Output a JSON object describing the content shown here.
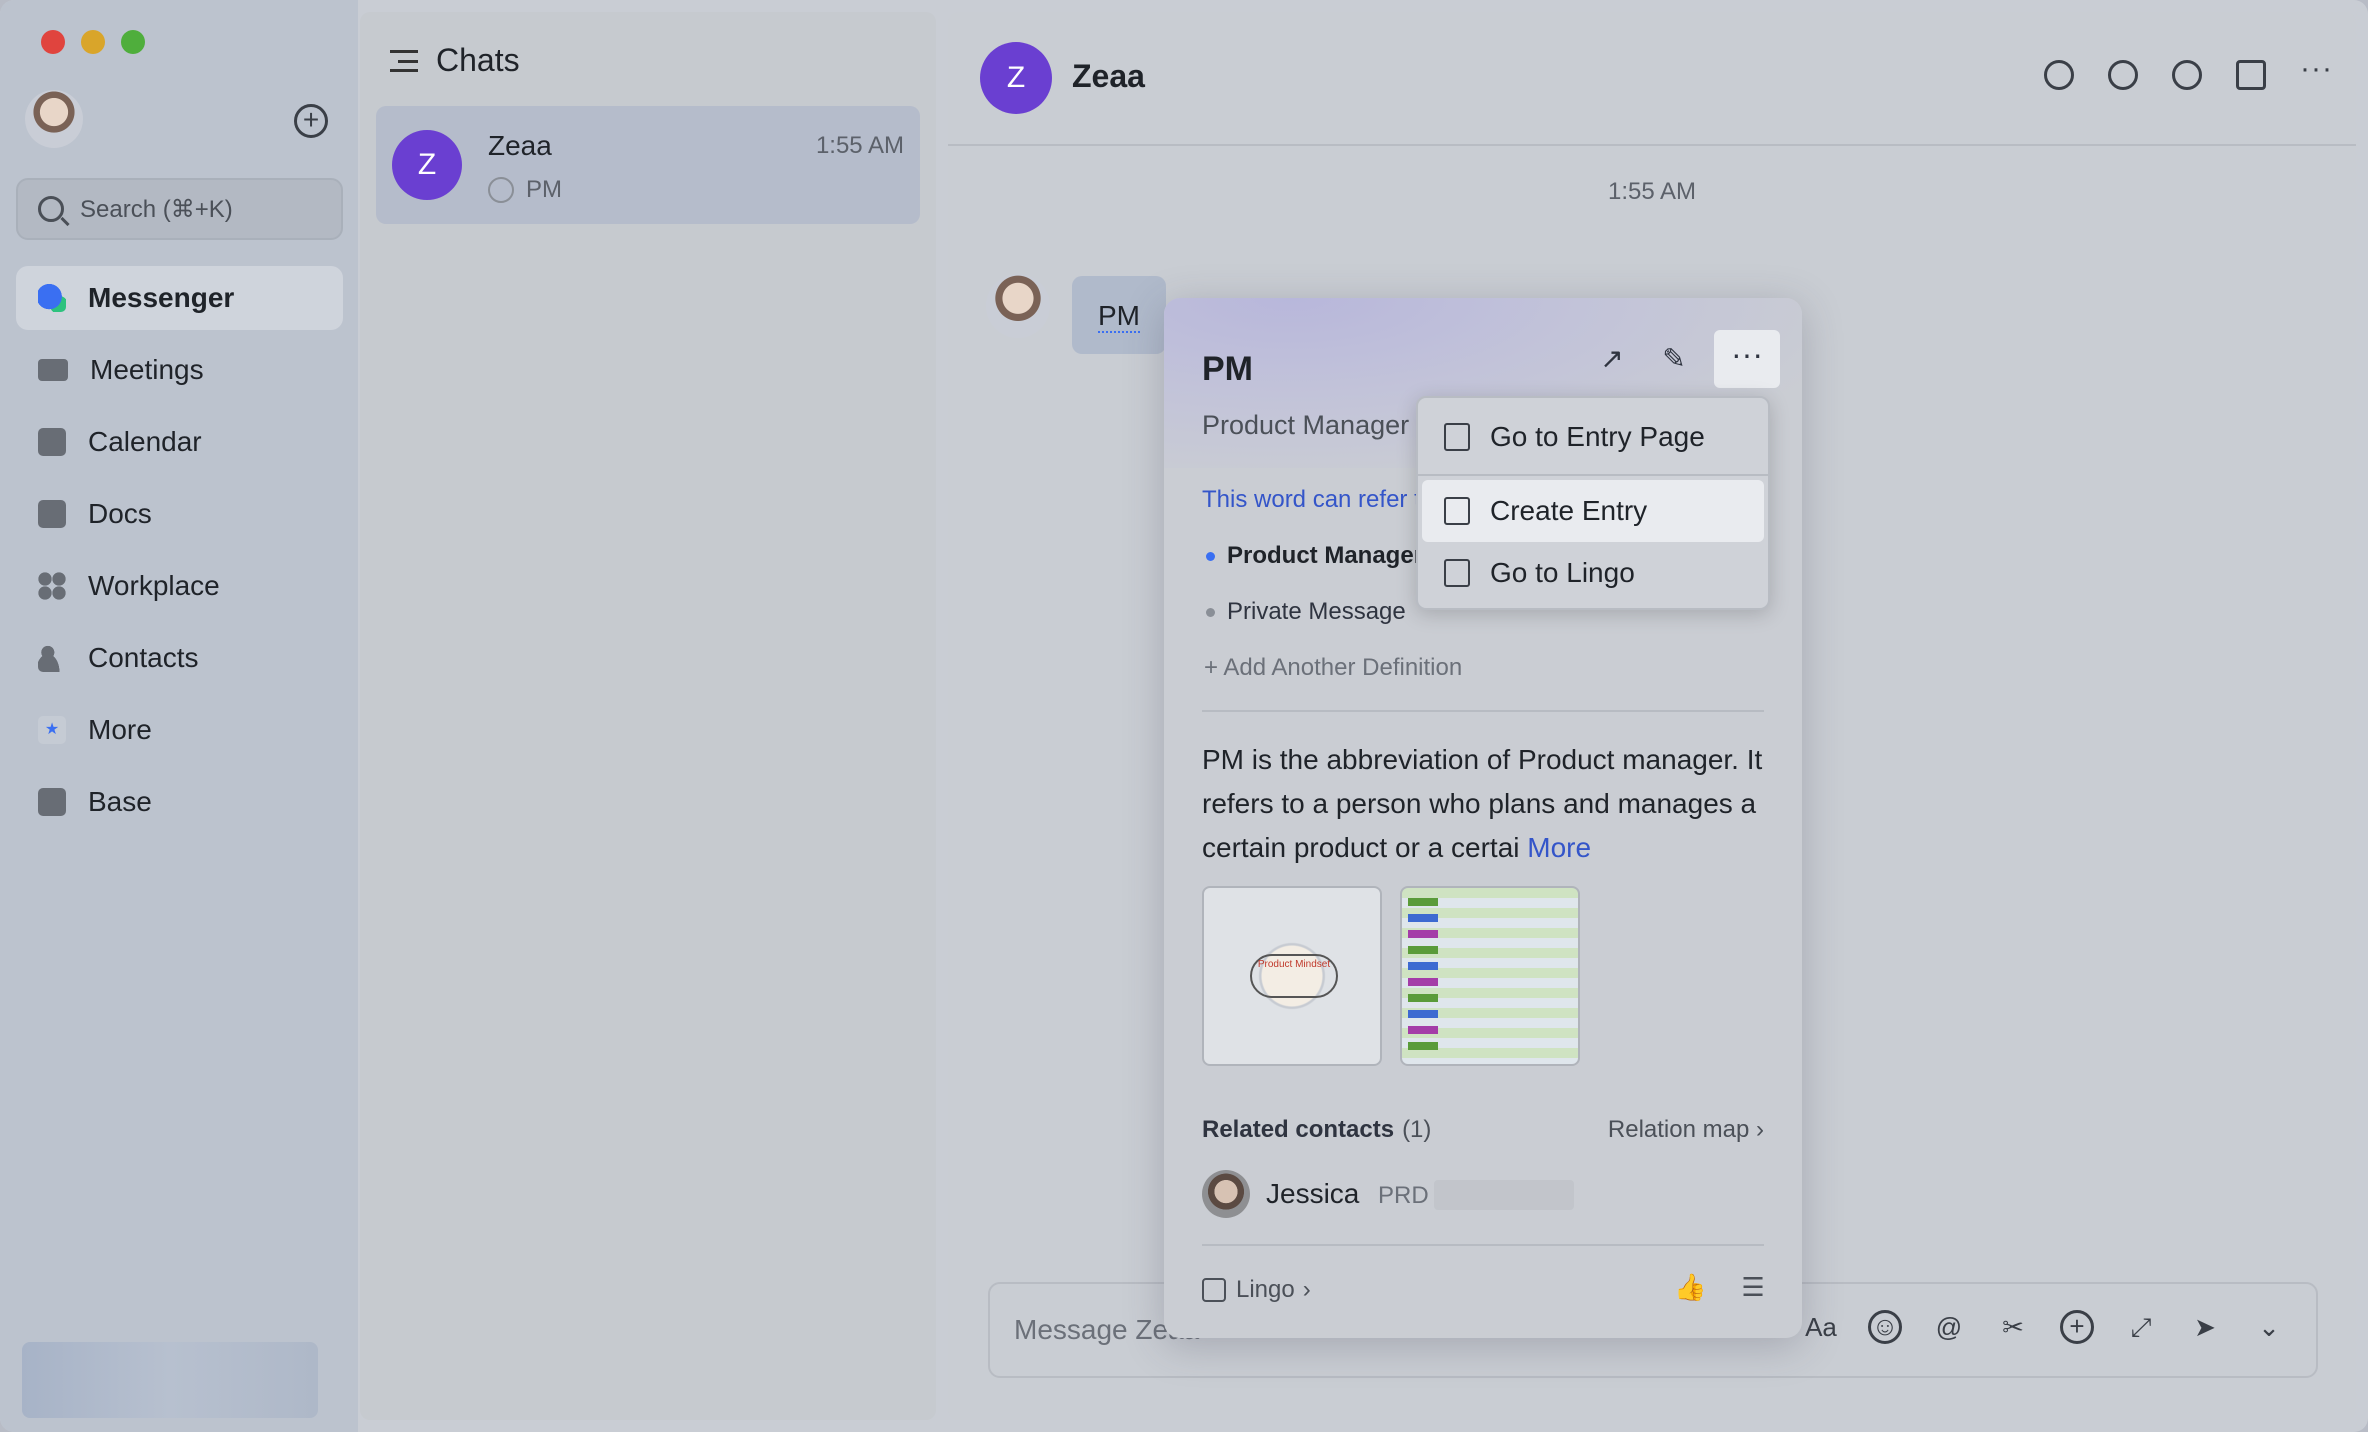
{
  "sidebar": {
    "search_placeholder": "Search (⌘+K)",
    "items": [
      {
        "label": "Messenger",
        "icon": "messenger-icon",
        "active": true
      },
      {
        "label": "Meetings",
        "icon": "video-camera-icon"
      },
      {
        "label": "Calendar",
        "icon": "calendar-icon"
      },
      {
        "label": "Docs",
        "icon": "docs-icon"
      },
      {
        "label": "Workplace",
        "icon": "grid-icon"
      },
      {
        "label": "Contacts",
        "icon": "contacts-icon"
      },
      {
        "label": "More",
        "icon": "more-apps-icon"
      },
      {
        "label": "Base",
        "icon": "base-table-icon"
      }
    ]
  },
  "chats": {
    "title": "Chats",
    "items": [
      {
        "avatar_letter": "Z",
        "name": "Zeaa",
        "time": "1:55 AM",
        "preview": "PM"
      }
    ]
  },
  "conversation": {
    "avatar_letter": "Z",
    "title": "Zeaa",
    "time_separator": "1:55 AM",
    "message": "PM",
    "composer_placeholder": "Message Zeaa"
  },
  "card": {
    "term": "PM",
    "subtitle": "Product Manager",
    "note": "This word can refer to",
    "definitions": [
      "Product Manager",
      "Private Message"
    ],
    "add_definition": "+ Add Another Definition",
    "description": "PM is the abbreviation of Product manager. It refers to a person who plans and manages a certain product or a certai",
    "more_link": "More",
    "thumb1_label": "Product Mindset",
    "related_label": "Related contacts",
    "related_count": "(1)",
    "relation_map": "Relation map",
    "contact": {
      "name": "Jessica",
      "tag": "PRD"
    },
    "footer_label": "Lingo"
  },
  "menu": {
    "items": [
      "Go to Entry Page",
      "Create Entry",
      "Go to Lingo"
    ]
  },
  "colors": {
    "accent": "#3a6ff2",
    "avatar_purple": "#6a3fd1",
    "link_blue": "#3455c9"
  }
}
